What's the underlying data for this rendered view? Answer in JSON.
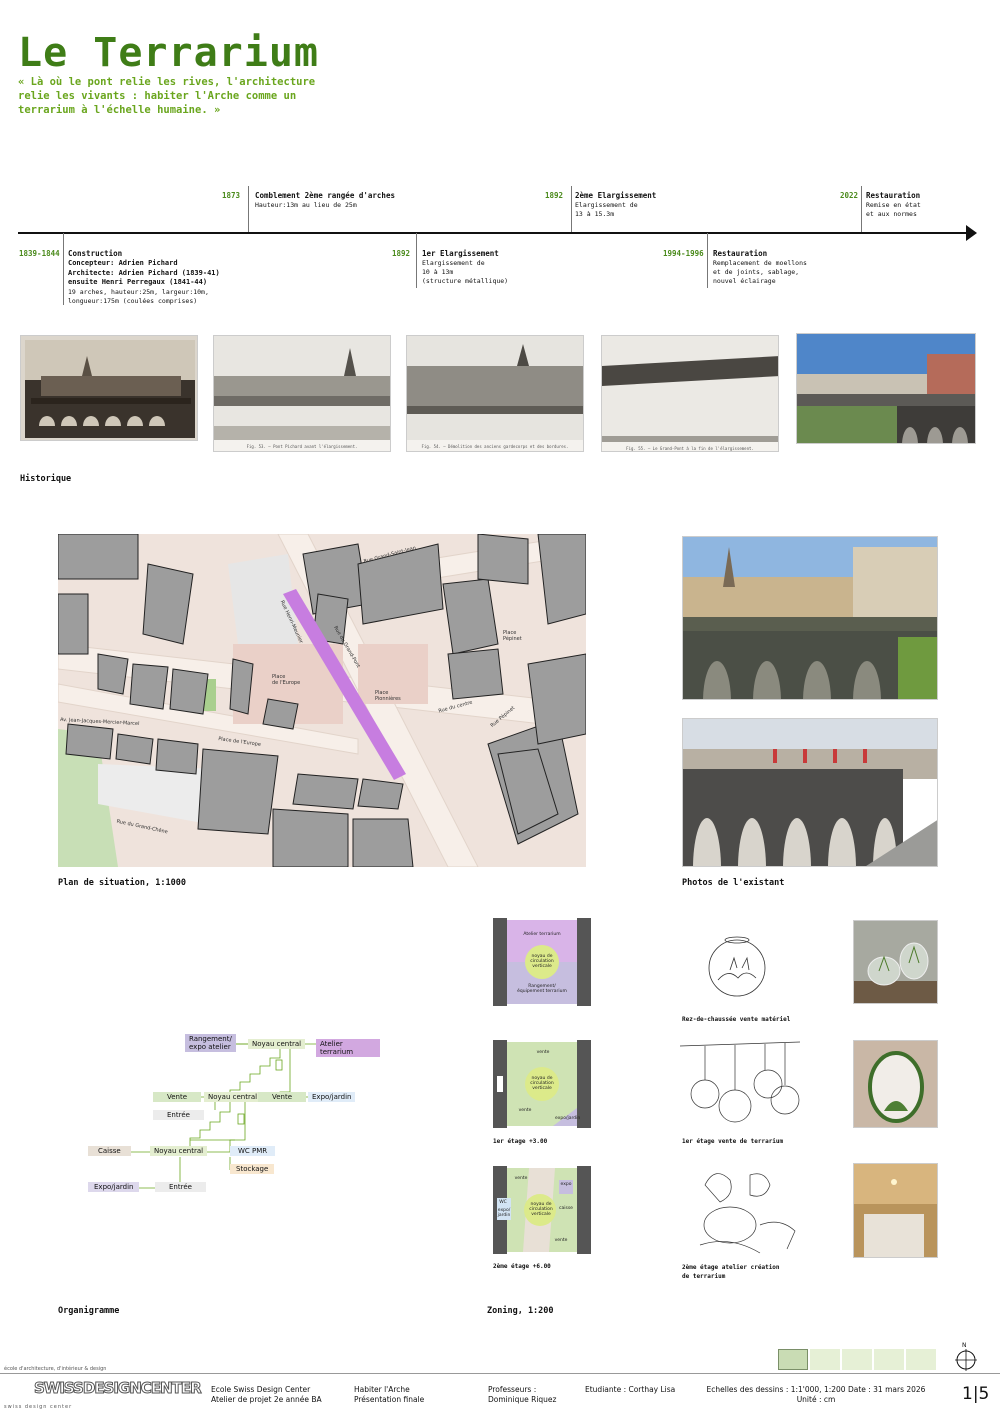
{
  "header": {
    "title": "Le Terrarium",
    "quote": "« Là où le pont relie les rives, l'architecture relie les vivants : habiter l'Arche comme un terrarium à l'échelle humaine. »"
  },
  "timeline": {
    "top": [
      {
        "year": "1873",
        "title": "Comblement 2ème rangée d'arches",
        "text": "Hauteur:13m au lieu de 25m"
      },
      {
        "year": "1892",
        "title": "2ème Elargissement",
        "text": "Elargissement de\n13 à 15.3m"
      },
      {
        "year": "2022",
        "title": "Restauration",
        "text": "Remise en état\net aux normes"
      }
    ],
    "bottom": [
      {
        "year": "1839-1844",
        "title": "Construction",
        "text_bold": "Concepteur: Adrien Pichard\nArchitecte: Adrien Pichard (1839-41)\nensuite Henri Perregaux (1841-44)",
        "text": "19 arches, hauteur:25m, largeur:10m,\nlongueur:175m (coulées comprises)"
      },
      {
        "year": "1892",
        "title": "1er Elargissement",
        "text": "Elargissement de\n10 à 13m\n(structure métallique)"
      },
      {
        "year": "1994-1996",
        "title": "Restauration",
        "text": "Remplacement de moellons\net de joints, sablage,\nnouvel éclairage"
      }
    ]
  },
  "historique": {
    "label": "Historique",
    "captions": [
      "",
      "Fig. 53. — Pont Pichard avant l'élargissement.",
      "Fig. 54. — Démolition des anciens gardecorps et des bordures.",
      "Fig. 55. — Le Grand-Pont à la fin de l'élargissement.",
      ""
    ]
  },
  "site_plan": {
    "label": "Plan de situation, 1:1000",
    "places": [
      "Place\nPépinet",
      "Place\nde l'Europe",
      "Place\nPionnières"
    ],
    "streets": [
      "Rue Grand-Saint-Jean",
      "Rue du Grand-Pont",
      "Rue du centre",
      "Rue Pépinet",
      "Av. Jean-Jacques-Mercier-Marcel",
      "Place de l'Europe",
      "Rue du Grand-Chêne",
      "Rue Henri-Meunier"
    ]
  },
  "photos_existant": {
    "label": "Photos de l'existant"
  },
  "organigramme": {
    "label": "Organigramme",
    "nodes": {
      "rangement": "Rangement/\nexpo atelier",
      "noyau1": "Noyau central",
      "atelier": "Atelier terrarium",
      "vente1": "Vente",
      "noyau2": "Noyau central",
      "vente2": "Vente",
      "expo1": "Expo/jardin",
      "entree1": "Entrée",
      "wc": "WC PMR",
      "caisse": "Caisse",
      "noyau3": "Noyau central",
      "stockage": "Stockage",
      "expo2": "Expo/jardin",
      "entree2": "Entrée"
    }
  },
  "zoning": {
    "label": "Zoning, 1:200",
    "floors": [
      {
        "caption": "",
        "zones": [
          "Atelier terrarium",
          "noyau de circulation verticale",
          "Rangement/ équipement terrarium"
        ]
      },
      {
        "caption": "1er étage +3.00",
        "zones": [
          "vente",
          "noyau de circulation verticale",
          "vente",
          "expo/jardin"
        ]
      },
      {
        "caption": "2ème étage +6.00",
        "zones": [
          "vente",
          "expo",
          "noyau de circulation verticale",
          "caisse",
          "vente",
          "WC",
          "expo/ jardin"
        ]
      }
    ]
  },
  "concepts": [
    {
      "caption": "Rez-de-chaussée vente matériel"
    },
    {
      "caption": "1er étage vente de terrarium"
    },
    {
      "caption": "2ème étage atelier création\nde terrarium"
    }
  ],
  "footer": {
    "school_tagline": "école d'architecture, d'intérieur & design",
    "logo": "SWISSDESIGNCENTER",
    "logo_sub": "swiss design center",
    "school": "Ecole Swiss Design Center\nAtelier de projet 2e année BA",
    "project": "Habiter l'Arche\nPrésentation finale",
    "profs": "Professeurs :\nDominique Riquez",
    "student": "Etudiante : Corthay Lisa",
    "scales": "Echelles des dessins : 1:1'000, 1:200  Date : 31 mars 2026\nUnité : cm",
    "page": "1|5",
    "north": "N"
  },
  "colors": {
    "green_title": "#3f7d17",
    "green_quote": "#6aa61e",
    "swatch_dark": "#c9dcb4",
    "swatch_light": "#e6f0d6",
    "purple": "#c49ad6",
    "lilac": "#c6bedf"
  }
}
